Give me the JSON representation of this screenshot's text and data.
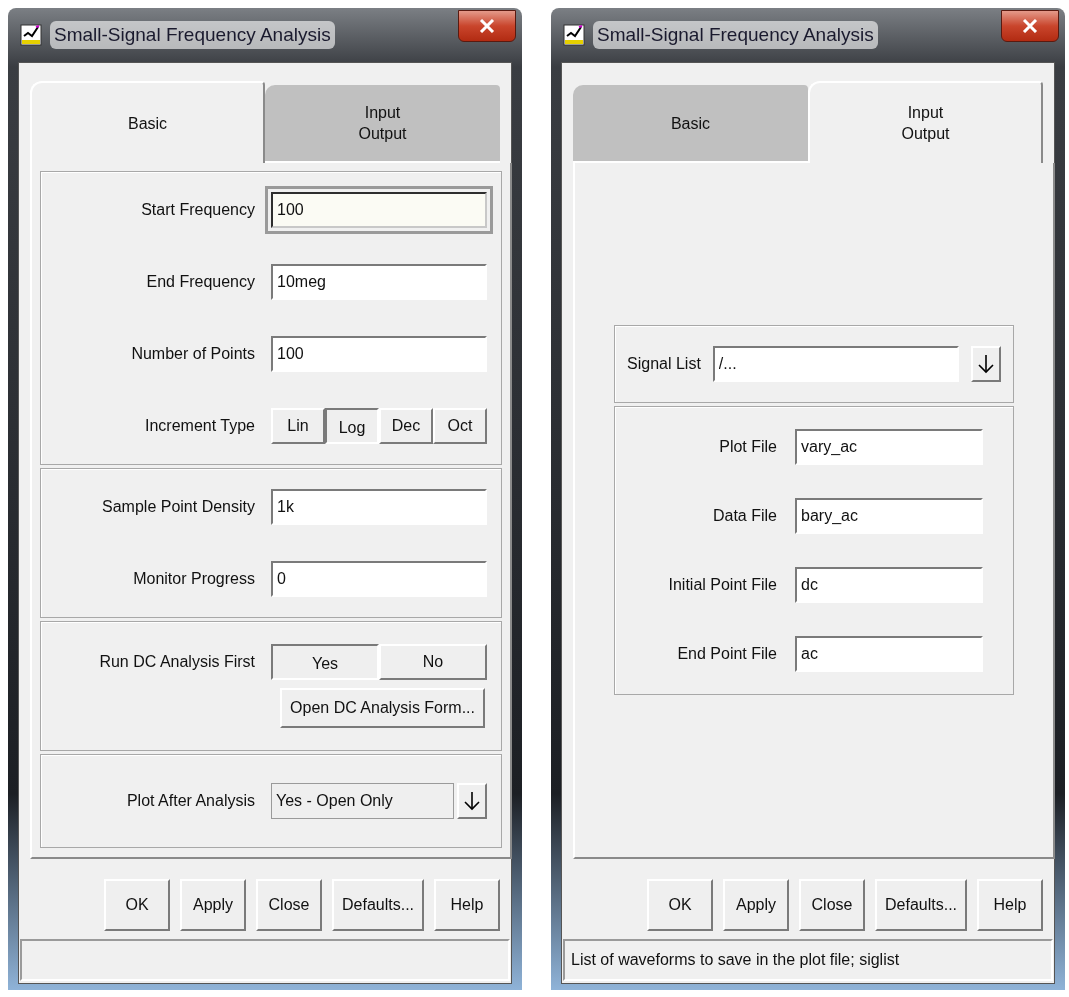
{
  "windows": [
    {
      "title": "Small-Signal Frequency Analysis",
      "tabs": [
        {
          "label": "Basic",
          "selected": true
        },
        {
          "label": "Input Output",
          "selected": false
        }
      ],
      "panel": {
        "kind": "form",
        "sections": [
          {
            "rows": [
              {
                "kind": "field",
                "label": "Start Frequency",
                "value": "100",
                "focused": true
              },
              {
                "kind": "field",
                "label": "End Frequency",
                "value": "10meg",
                "focused": false
              },
              {
                "kind": "field",
                "label": "Number of Points",
                "value": "100",
                "focused": false
              },
              {
                "kind": "choice",
                "label": "Increment Type",
                "options": [
                  {
                    "label": "Lin",
                    "selected": false
                  },
                  {
                    "label": "Log",
                    "selected": true
                  },
                  {
                    "label": "Dec",
                    "selected": false
                  },
                  {
                    "label": "Oct",
                    "selected": false
                  }
                ]
              }
            ]
          },
          {
            "rows": [
              {
                "kind": "field",
                "label": "Sample Point Density",
                "value": "1k",
                "focused": false
              },
              {
                "kind": "field",
                "label": "Monitor Progress",
                "value": "0",
                "focused": false
              }
            ]
          },
          {
            "rows": [
              {
                "kind": "choice",
                "label": "Run DC Analysis First",
                "options": [
                  {
                    "label": "Yes",
                    "selected": true
                  },
                  {
                    "label": "No",
                    "selected": false
                  }
                ]
              },
              {
                "kind": "action",
                "label": "Open DC Analysis Form..."
              }
            ]
          },
          {
            "rows": [
              {
                "kind": "dropdown",
                "label": "Plot After Analysis",
                "value": "Yes - Open Only"
              }
            ]
          }
        ]
      },
      "buttons": [
        "OK",
        "Apply",
        "Close",
        "Defaults...",
        "Help"
      ]
    },
    {
      "title": "Small-Signal Frequency Analysis",
      "tabs": [
        {
          "label": "Basic",
          "selected": false
        },
        {
          "label": "Input Output",
          "selected": true
        }
      ],
      "panel": {
        "kind": "centered",
        "sections": [
          {
            "rows": [
              {
                "kind": "combo",
                "label": "Signal List",
                "value": "/..."
              }
            ]
          },
          {
            "rows": [
              {
                "kind": "field",
                "label": "Plot File",
                "value": "vary_ac",
                "focused": false
              },
              {
                "kind": "field",
                "label": "Data File",
                "value": "bary_ac",
                "focused": false
              },
              {
                "kind": "field",
                "label": "Initial Point File",
                "value": "dc",
                "focused": false
              },
              {
                "kind": "field",
                "label": "End Point File",
                "value": "ac",
                "focused": false
              }
            ]
          }
        ]
      },
      "buttons": [
        "OK",
        "Apply",
        "Close",
        "Defaults...",
        "Help"
      ],
      "status_bar": "List of waveforms to save in the plot file; siglist"
    }
  ]
}
